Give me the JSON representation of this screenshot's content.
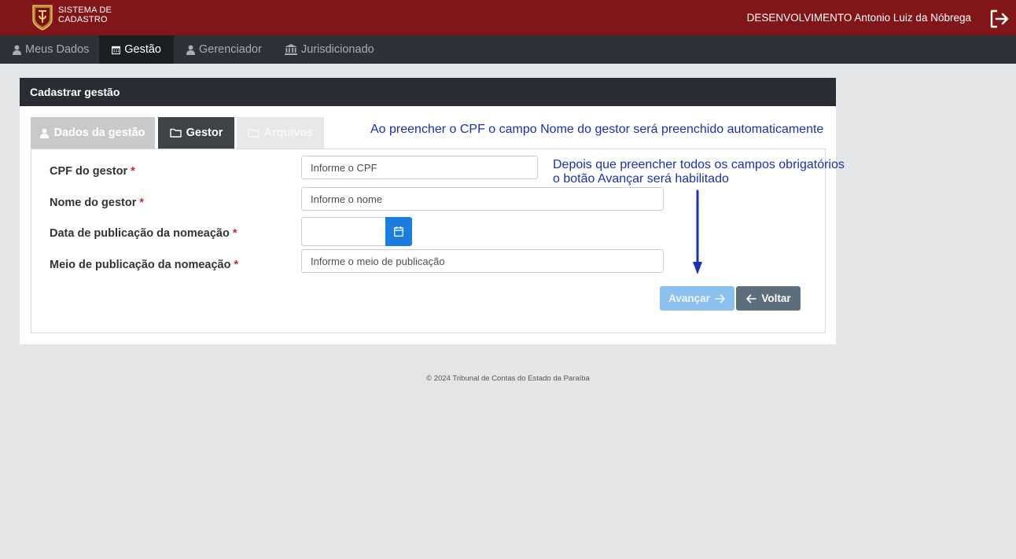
{
  "header": {
    "brand_line1": "SISTEMA DE",
    "brand_line2": "CADASTRO",
    "user": "DESENVOLVIMENTO Antonio Luiz da Nóbrega",
    "logo_icon": "tce-crest-logo",
    "logout_icon": "logout-icon",
    "brand_color": "#821518"
  },
  "nav": {
    "items": [
      {
        "label": "Meus Dados",
        "icon": "user-icon",
        "active": false
      },
      {
        "label": "Gestão",
        "icon": "calendar-icon",
        "active": true
      },
      {
        "label": "Gerenciador",
        "icon": "user-icon",
        "active": false
      },
      {
        "label": "Jurisdicionado",
        "icon": "bank-icon",
        "active": false
      }
    ]
  },
  "card": {
    "title": "Cadastrar gestão",
    "tabs": [
      {
        "label": "Dados da gestão",
        "icon": "user-icon",
        "state": "inactive"
      },
      {
        "label": "Gestor",
        "icon": "folder-icon",
        "state": "active"
      },
      {
        "label": "Arquivos",
        "icon": "folder-icon",
        "state": "disabled"
      }
    ],
    "note_cpf": "Ao preencher o CPF o campo Nome do gestor será preenchido automaticamente",
    "note_avancar_line1": "Depois que preencher todos os campos obrigatórios",
    "note_avancar_line2": "o botão Avançar será habilitado",
    "required_marker": "*",
    "form": {
      "cpf_label": "CPF do gestor",
      "cpf_placeholder": "Informe o CPF",
      "cpf_value": "",
      "nome_label": "Nome do gestor",
      "nome_placeholder": "Informe o nome",
      "nome_value": "",
      "data_label": "Data de publicação da nomeação",
      "data_value": "",
      "meio_label": "Meio de publicação da nomeação",
      "meio_placeholder": "Informe o meio de publicação",
      "meio_value": ""
    },
    "buttons": {
      "avancar": "Avançar",
      "avancar_enabled": false,
      "voltar": "Voltar"
    }
  },
  "footer": {
    "text": "© 2024 Tribunal de Contas do Estado da Paraíba"
  },
  "colors": {
    "accent_blue": "#1a7de0",
    "annotation_blue": "#1a2fb5",
    "required_red": "#d0232e"
  }
}
